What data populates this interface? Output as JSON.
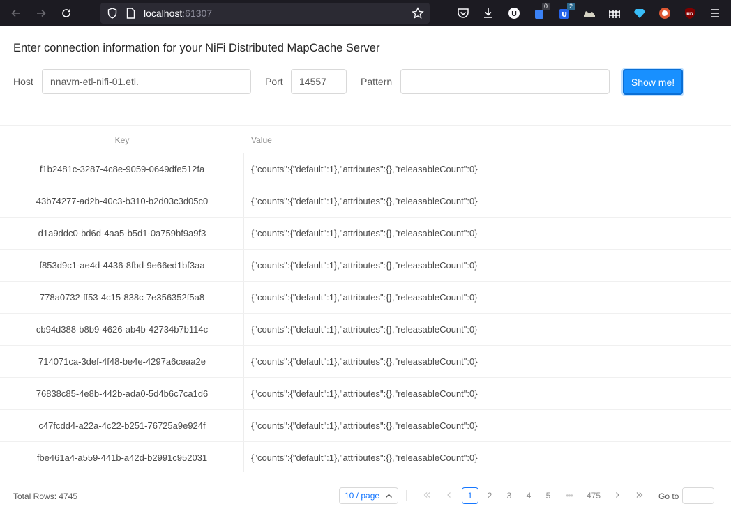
{
  "browser": {
    "url_host": "localhost",
    "url_port": ":61307"
  },
  "heading": "Enter connection information for your NiFi Distributed MapCache Server",
  "form": {
    "host_label": "Host",
    "host_value": "nnavm-etl-nifi-01.etl. ",
    "port_label": "Port",
    "port_value": "14557",
    "pattern_label": "Pattern",
    "pattern_value": "",
    "submit_label": "Show me!"
  },
  "table": {
    "columns": [
      "Key",
      "Value"
    ],
    "rows": [
      {
        "key": "f1b2481c-3287-4c8e-9059-0649dfe512fa",
        "value": "{\"counts\":{\"default\":1},\"attributes\":{},\"releasableCount\":0}"
      },
      {
        "key": "43b74277-ad2b-40c3-b310-b2d03c3d05c0",
        "value": "{\"counts\":{\"default\":1},\"attributes\":{},\"releasableCount\":0}"
      },
      {
        "key": "d1a9ddc0-bd6d-4aa5-b5d1-0a759bf9a9f3",
        "value": "{\"counts\":{\"default\":1},\"attributes\":{},\"releasableCount\":0}"
      },
      {
        "key": "f853d9c1-ae4d-4436-8fbd-9e66ed1bf3aa",
        "value": "{\"counts\":{\"default\":1},\"attributes\":{},\"releasableCount\":0}"
      },
      {
        "key": "778a0732-ff53-4c15-838c-7e356352f5a8",
        "value": "{\"counts\":{\"default\":1},\"attributes\":{},\"releasableCount\":0}"
      },
      {
        "key": "cb94d388-b8b9-4626-ab4b-42734b7b114c",
        "value": "{\"counts\":{\"default\":1},\"attributes\":{},\"releasableCount\":0}"
      },
      {
        "key": "714071ca-3def-4f48-be4e-4297a6ceaa2e",
        "value": "{\"counts\":{\"default\":1},\"attributes\":{},\"releasableCount\":0}"
      },
      {
        "key": "76838c85-4e8b-442b-ada0-5d4b6c7ca1d6",
        "value": "{\"counts\":{\"default\":1},\"attributes\":{},\"releasableCount\":0}"
      },
      {
        "key": "c47fcdd4-a22a-4c22-b251-76725a9e924f",
        "value": "{\"counts\":{\"default\":1},\"attributes\":{},\"releasableCount\":0}"
      },
      {
        "key": "fbe461a4-a559-441b-a42d-b2991c952031",
        "value": "{\"counts\":{\"default\":1},\"attributes\":{},\"releasableCount\":0}"
      }
    ]
  },
  "footer": {
    "total_rows": "Total Rows: 4745",
    "page_size": "10 / page",
    "pages": [
      "1",
      "2",
      "3",
      "4",
      "5",
      "•••",
      "475"
    ],
    "current_page": "1",
    "goto_label": "Go to"
  },
  "extensions": {
    "badge_1": "0",
    "badge_2": "2"
  },
  "colors": {
    "primary": "#1890ff",
    "browser_bg": "#1c1b22",
    "urlbar_bg": "#2b2a33"
  }
}
